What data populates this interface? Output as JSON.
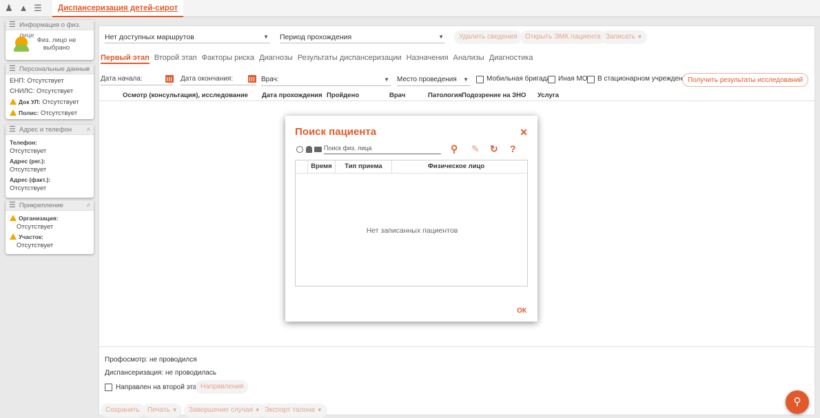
{
  "header": {
    "active_tab": "Диспансеризация детей-сирот",
    "icons": [
      "user-icon",
      "bell-icon",
      "menu-icon"
    ]
  },
  "sidebar": {
    "info": {
      "title": "Информация о физ. лице",
      "person": "Физ. лицо не выбрано"
    },
    "personal": {
      "title": "Персональные данные",
      "enp_label": "ЕНП:",
      "enp_value": "Отсутствует",
      "snils_label": "СНИЛС:",
      "snils_value": "Отсутствует",
      "doc_label": "Док УЛ:",
      "doc_value": "Отсутствует",
      "polis_label": "Полис:",
      "polis_value": "Отсутствует"
    },
    "address": {
      "title": "Адрес и телефон",
      "phone_label": "Телефон:",
      "phone_value": "Отсутствует",
      "addr_reg_label": "Адрес (рег.):",
      "addr_reg_value": "Отсутствует",
      "addr_fact_label": "Адрес (факт.):",
      "addr_fact_value": "Отсутствует"
    },
    "attachment": {
      "title": "Прикрепление",
      "org_label": "Организация:",
      "org_value": "Отсутствует",
      "area_label": "Участок:",
      "area_value": "Отсутствует"
    }
  },
  "toolbar": {
    "routes_select": "Нет доступных маршрутов",
    "period_select": "Период прохождения",
    "delete_btn": "Удалить сведения",
    "open_emk_btn": "Открыть ЭМК пациента",
    "record_btn": "Записать"
  },
  "tabs": [
    "Первый этап",
    "Второй этап",
    "Факторы риска",
    "Диагнозы",
    "Результаты диспансеризации",
    "Назначения",
    "Анализы",
    "Диагностика"
  ],
  "filters": {
    "date_start": "Дата начала:",
    "date_end": "Дата окончания:",
    "doctor": "Врач:",
    "place": "Место проведения",
    "mobile": "Мобильная бригада",
    "other_mo": "Иная МО",
    "stationary": "В стационарном учреждении",
    "get_results_btn": "Получить результаты исследований"
  },
  "table": {
    "columns": [
      "Осмотр (консультация), исследование",
      "Дата прохождения",
      "Пройдено",
      "Врач",
      "Патология",
      "Подозрение на ЗНО",
      "Услуга"
    ]
  },
  "footer": {
    "profosmotr": "Профосмотр: не проводился",
    "dispanser": "Диспансеризация: не проводилась",
    "second_stage": "Направлен на второй этап",
    "directions_btn": "Направления",
    "save_btn": "Сохранить",
    "print_btn": "Печать",
    "close_case_btn": "Завершение случая",
    "export_btn": "Экспорт талона"
  },
  "modal": {
    "title": "Поиск пациента",
    "search_placeholder": "Поиск физ. лица",
    "columns": [
      "Время",
      "Тип приема",
      "Физическое лицо"
    ],
    "empty": "Нет записанных пациентов",
    "ok": "ОК"
  },
  "colors": {
    "accent": "#e05a2b",
    "warning": "#f0a500"
  }
}
